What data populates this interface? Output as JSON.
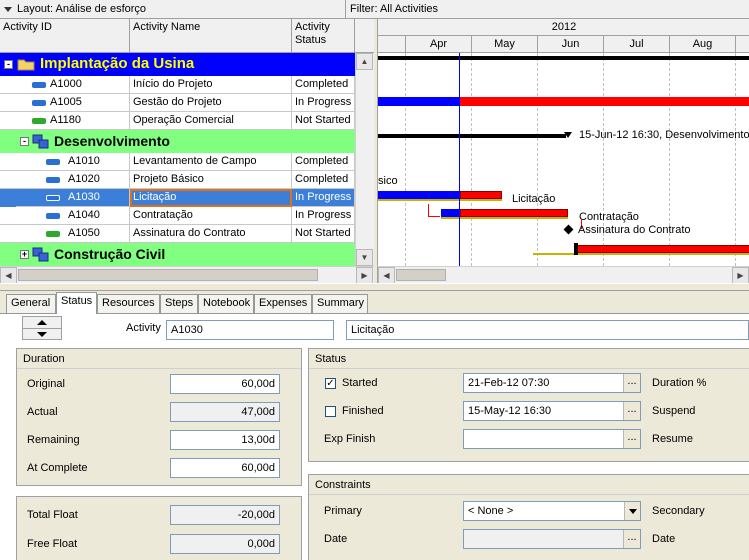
{
  "topbar": {
    "layout_label": "Layout: Análise de esforço",
    "filter_label": "Filter: All Activities"
  },
  "grid": {
    "columns": [
      "Activity ID",
      "Activity Name",
      "Activity Status"
    ],
    "wbs": [
      {
        "name": "Implantação da Usina",
        "bg": "#0000ff",
        "fg": "#ffff00",
        "expander": "-"
      },
      {
        "name": "Desenvolvimento",
        "bg": "#80ff80",
        "fg": "#000000",
        "expander": "-"
      },
      {
        "name": "Construção Civil",
        "bg": "#80ff80",
        "fg": "#000000",
        "expander": "+"
      }
    ],
    "activities": [
      {
        "id": "A1000",
        "name": "Início do Projeto",
        "status": "Completed",
        "color": "#2a6fd4"
      },
      {
        "id": "A1005",
        "name": "Gestão do Projeto",
        "status": "In Progress",
        "color": "#2a6fd4"
      },
      {
        "id": "A1180",
        "name": "Operação Comercial",
        "status": "Not Started",
        "color": "#2fa82f"
      },
      {
        "id": "A1010",
        "name": "Levantamento de Campo",
        "status": "Completed",
        "color": "#2a6fd4"
      },
      {
        "id": "A1020",
        "name": "Projeto Básico",
        "status": "Completed",
        "color": "#2a6fd4"
      },
      {
        "id": "A1030",
        "name": "Licitação",
        "status": "In Progress",
        "color": "#2a6fd4"
      },
      {
        "id": "A1040",
        "name": "Contratação",
        "status": "In Progress",
        "color": "#2a6fd4"
      },
      {
        "id": "A1050",
        "name": "Assinatura do Contrato",
        "status": "Not Started",
        "color": "#2fa82f"
      }
    ]
  },
  "gantt": {
    "year": "2012",
    "months": [
      "Apr",
      "May",
      "Jun",
      "Jul",
      "Aug"
    ],
    "labels": {
      "desenvolvimento": "15-Jun-12 16:30, Desenvolvimento",
      "projeto_basico": "sico",
      "licitacao": "Licitação",
      "contratacao": "Contratação",
      "assinatura": "Assinatura do Contrato"
    }
  },
  "tabs": [
    "General",
    "Status",
    "Resources",
    "Steps",
    "Notebook",
    "Expenses",
    "Summary"
  ],
  "status_tab": {
    "activity_label": "Activity",
    "activity_id": "A1030",
    "activity_name": "Licitação",
    "duration": {
      "title": "Duration",
      "original_label": "Original",
      "original": "60,00d",
      "actual_label": "Actual",
      "actual": "47,00d",
      "remaining_label": "Remaining",
      "remaining": "13,00d",
      "at_complete_label": "At Complete",
      "at_complete": "60,00d"
    },
    "float": {
      "total_label": "Total Float",
      "total": "-20,00d",
      "free_label": "Free Float",
      "free": "0,00d"
    },
    "status": {
      "title": "Status",
      "started_label": "Started",
      "started_date": "21-Feb-12 07:30",
      "finished_label": "Finished",
      "finished_date": "15-May-12 16:30",
      "exp_finish_label": "Exp Finish",
      "exp_finish": "",
      "duration_pct_label": "Duration %",
      "suspend_label": "Suspend",
      "resume_label": "Resume"
    },
    "constraints": {
      "title": "Constraints",
      "primary_label": "Primary",
      "primary": "< None >",
      "date_label": "Date",
      "date": "",
      "secondary_label": "Secondary",
      "date2_label": "Date"
    }
  },
  "colors": {
    "selected_row": "#3c7fd8",
    "bar_remaining": "#ff0000",
    "bar_actual": "#0000ff",
    "data_date_line": "#0000ff"
  }
}
